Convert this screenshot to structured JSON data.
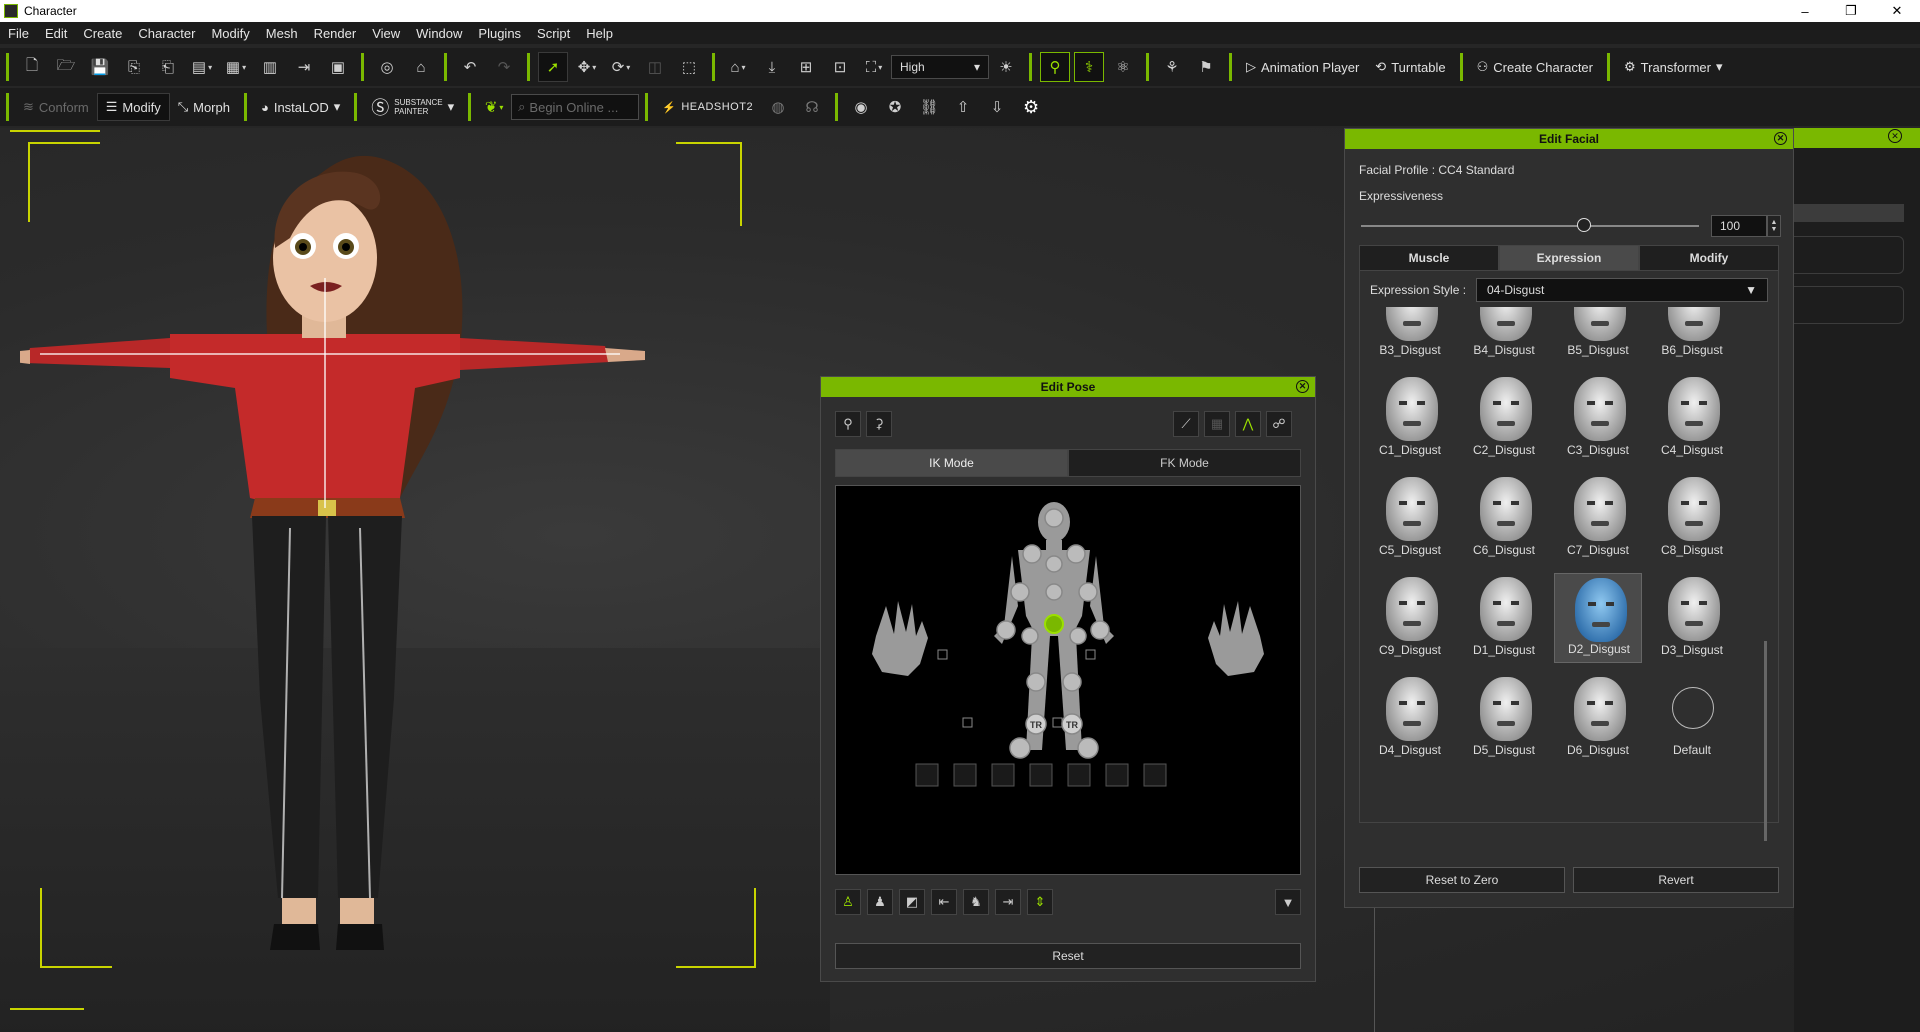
{
  "window": {
    "title": "Character",
    "minimize": "–",
    "maximize": "❐",
    "close": "✕"
  },
  "menu": [
    "File",
    "Edit",
    "Create",
    "Character",
    "Modify",
    "Mesh",
    "Render",
    "View",
    "Window",
    "Plugins",
    "Script",
    "Help"
  ],
  "toolbar1": {
    "quality": "High",
    "animation_player": "Animation Player",
    "turntable": "Turntable",
    "create_character": "Create Character",
    "transformer": "Transformer"
  },
  "toolbar2": {
    "conform": "Conform",
    "modify": "Modify",
    "morph": "Morph",
    "instalod": "InstaLOD",
    "substance_line1": "SUBSTANCE",
    "substance_line2": "PAINTER",
    "search_placeholder": "Begin Online ...",
    "headshot": "HEADSHOT2"
  },
  "edit_pose": {
    "title": "Edit Pose",
    "tabs": [
      "IK Mode",
      "FK Mode"
    ],
    "selected_tab": "IK Mode",
    "tr_left": "TR",
    "tr_right": "TR",
    "reset": "Reset"
  },
  "edit_facial": {
    "title": "Edit Facial",
    "profile": "Facial Profile : CC4 Standard",
    "expressiveness_label": "Expressiveness",
    "expressiveness_value": "100",
    "expressiveness_level": 0.66,
    "tabs": [
      "Muscle",
      "Expression",
      "Modify"
    ],
    "selected_tab": "Expression",
    "style_label": "Expression Style :",
    "style_value": "04-Disgust",
    "expressions": [
      [
        "B3_Disgust",
        "B4_Disgust",
        "B5_Disgust",
        "B6_Disgust"
      ],
      [
        "C1_Disgust",
        "C2_Disgust",
        "C3_Disgust",
        "C4_Disgust"
      ],
      [
        "C5_Disgust",
        "C6_Disgust",
        "C7_Disgust",
        "C8_Disgust"
      ],
      [
        "C9_Disgust",
        "D1_Disgust",
        "D2_Disgust",
        "D3_Disgust"
      ],
      [
        "D4_Disgust",
        "D5_Disgust",
        "D6_Disgust",
        "Default"
      ]
    ],
    "selected_expression": "D2_Disgust",
    "reset_to_zero": "Reset to Zero",
    "revert": "Revert"
  },
  "colors": {
    "accent": "#7ab800",
    "panel": "#2f2f2f",
    "selection": "#4a4a4a"
  }
}
